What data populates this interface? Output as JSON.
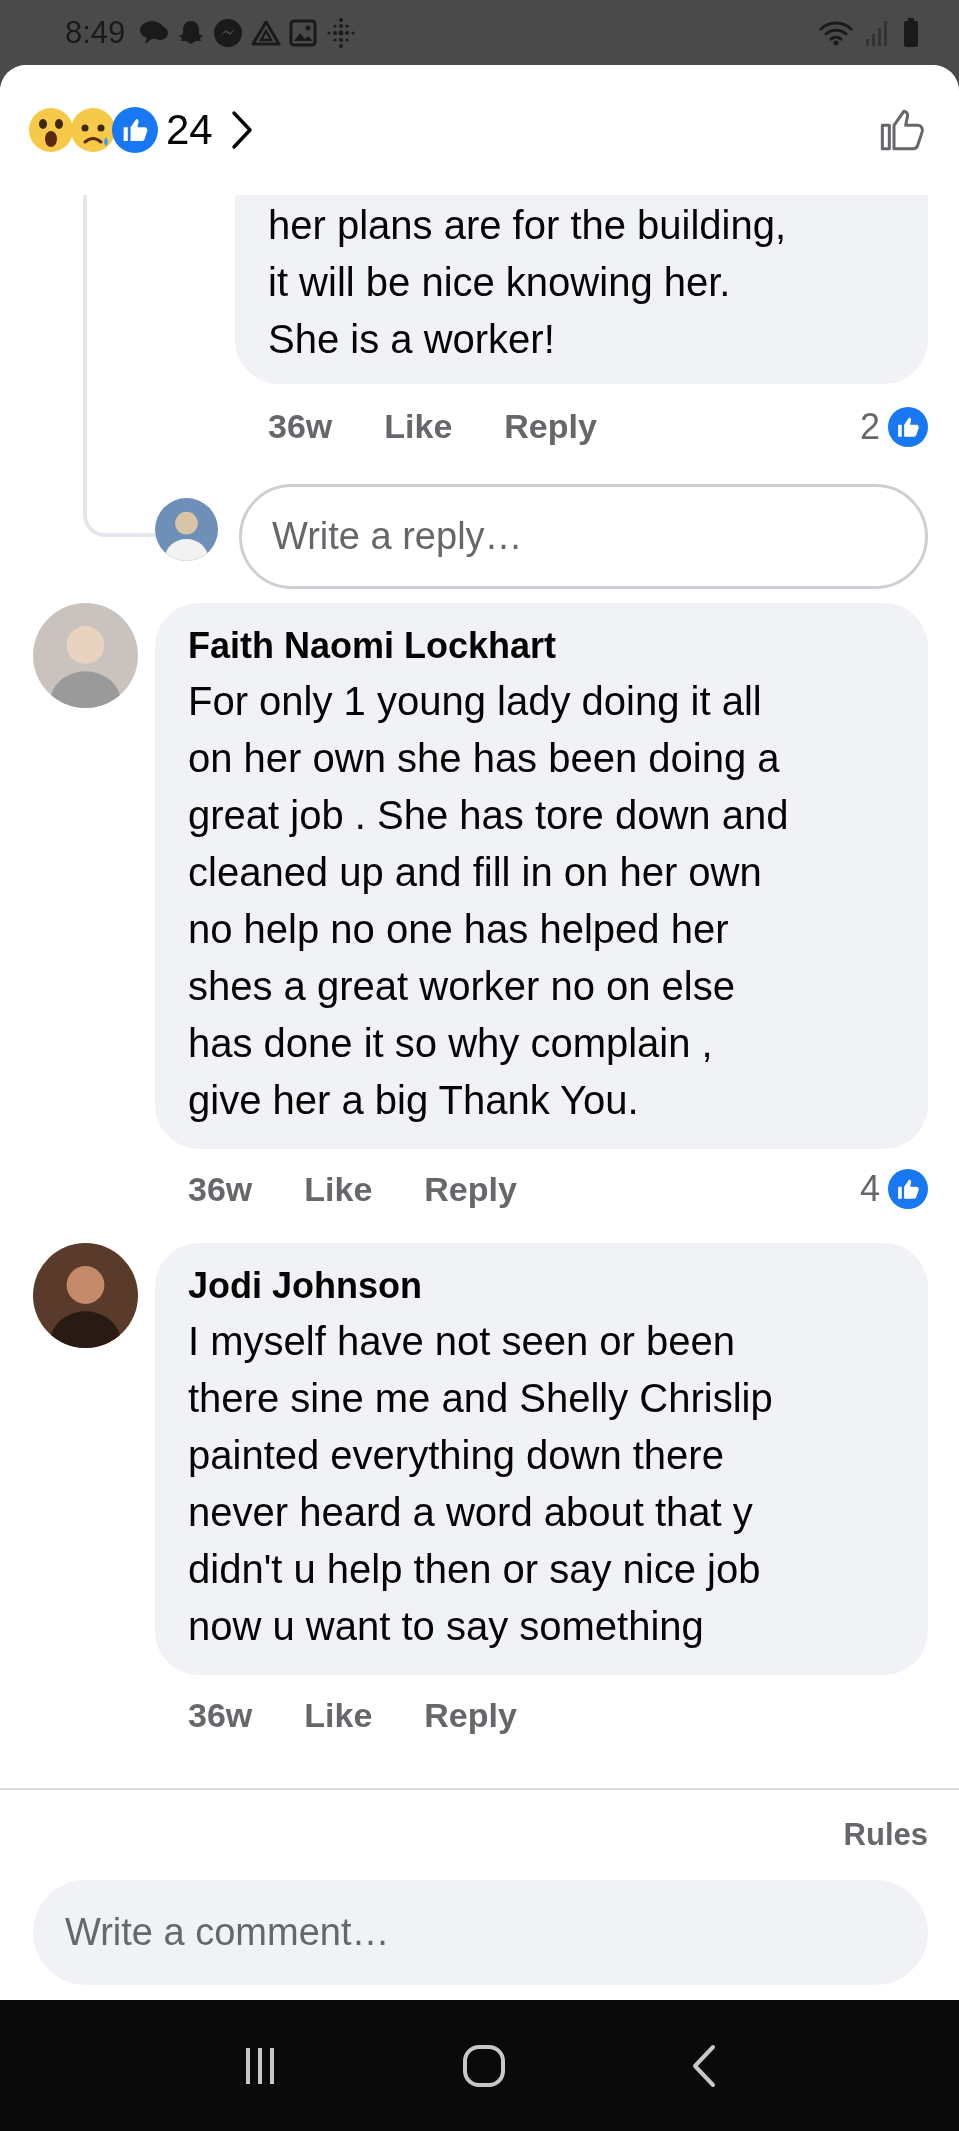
{
  "status_bar": {
    "time": "8:49"
  },
  "reactions": {
    "count": "24"
  },
  "thread": {
    "comment": {
      "text": "her plans are for the building,\nit will be nice knowing her.\nShe is a worker!",
      "time": "36w",
      "like_label": "Like",
      "reply_label": "Reply",
      "like_count": "2"
    },
    "reply_field": {
      "placeholder": "Write a reply…"
    }
  },
  "comments": [
    {
      "author": "Faith Naomi Lockhart",
      "text": "For only 1 young lady doing it all\non her own she has been doing a\ngreat job . She has tore down and\ncleaned up and fill in on her own\nno help no one has helped her\nshes a great worker no on else\nhas done it so why complain ,\ngive her a big Thank You.",
      "time": "36w",
      "like_label": "Like",
      "reply_label": "Reply",
      "like_count": "4"
    },
    {
      "author": "Jodi Johnson",
      "text": "I myself have not seen or been\nthere sine me and Shelly Chrislip\npainted everything down there\nnever heard a word about that y\ndidn't u help then or say nice job\nnow u want to say something",
      "time": "36w",
      "like_label": "Like",
      "reply_label": "Reply"
    }
  ],
  "rules_link": "Rules",
  "comment_field": {
    "placeholder": "Write a comment…"
  }
}
